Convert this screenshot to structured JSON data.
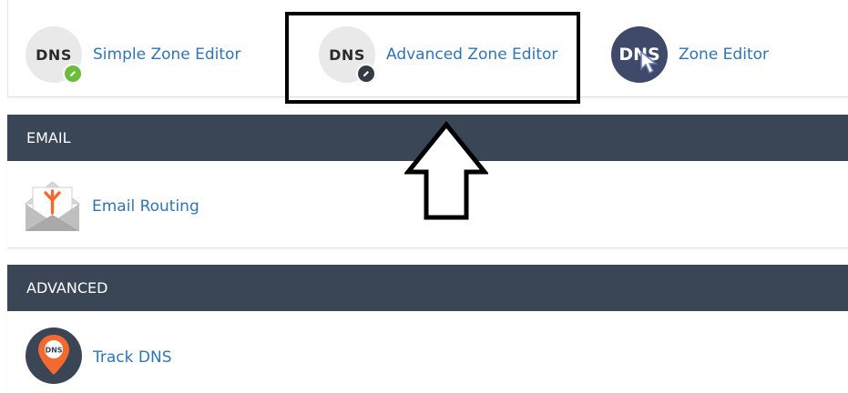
{
  "domains": {
    "items": [
      {
        "label": "Simple Zone Editor",
        "icon": "dns-edit-icon",
        "badge_color": "#6abd3b"
      },
      {
        "label": "Advanced Zone Editor",
        "icon": "dns-edit-icon",
        "badge_color": "#333b46"
      },
      {
        "label": "Zone Editor",
        "icon": "dns-cursor-icon"
      }
    ],
    "icon_text": "DNS"
  },
  "email": {
    "title": "EMAIL",
    "items": [
      {
        "label": "Email Routing",
        "icon": "envelope-routing-icon"
      }
    ]
  },
  "advanced": {
    "title": "ADVANCED",
    "items": [
      {
        "label": "Track DNS",
        "icon": "map-pin-dns-icon",
        "pin_text": "DNS"
      }
    ]
  },
  "colors": {
    "header_bg": "#3a4556",
    "link": "#2f75b6",
    "accent_orange": "#f26a2e"
  },
  "annotations": {
    "highlight": "box around Advanced Zone Editor",
    "arrow": "up-arrow-outline"
  }
}
